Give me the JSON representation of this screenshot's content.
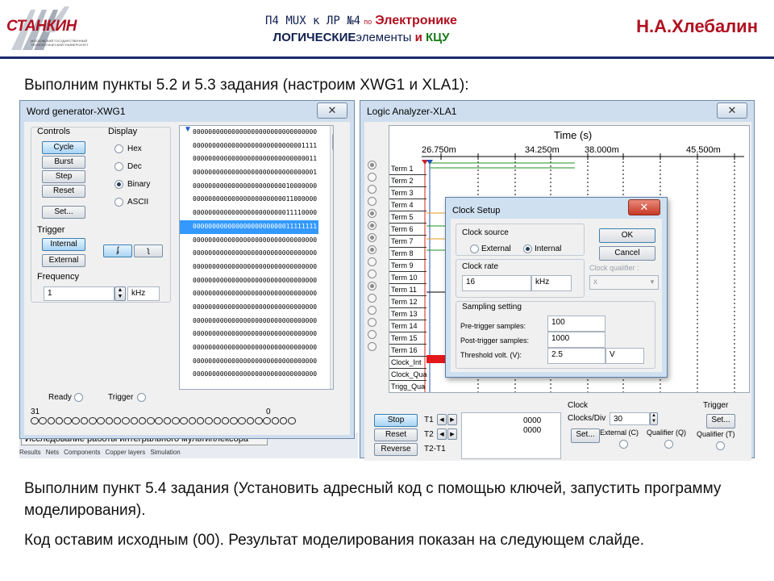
{
  "header": {
    "logo": {
      "brand": "СТАНКИН",
      "subtitle": "МОСКОВСКИЙ ГОСУДАРСТВЕННЫЙ ТЕХНОЛОГИЧЕСКИЙ УНИВЕРСИТЕТ"
    },
    "line1": {
      "part1": "П4 MUX к ЛР №4",
      "part2": "по",
      "part3": "Электронике"
    },
    "line2": {
      "part1": "ЛОГИЧЕСКИЕ",
      "part2": "элементы",
      "part3": "и",
      "part4": "КЦУ"
    },
    "author": "Н.А.Хлебалин",
    "colors": {
      "accent": "#b01020",
      "navy": "#1a2a6e",
      "green": "#1a7a1a"
    }
  },
  "text": {
    "p1": "Выполним пункты 5.2 и 5.3 задания (настроим XWG1 и XLA1):",
    "p2": "Выполним пункт 5.4 задания (Установить адресный код с помощью ключей, запустить программу моделирования).",
    "p3": "Код оставим исходным (00). Результат моделирования показан на следующем слайде."
  },
  "word_generator": {
    "title": "Word generator-XWG1",
    "controls": {
      "label": "Controls",
      "cycle": "Cycle",
      "burst": "Burst",
      "step": "Step",
      "reset": "Reset",
      "set": "Set..."
    },
    "display": {
      "label": "Display",
      "hex": "Hex",
      "dec": "Dec",
      "binary": "Binary",
      "ascii": "ASCII",
      "selected": "Binary"
    },
    "trigger": {
      "label": "Trigger",
      "internal": "Internal",
      "external": "External",
      "edge_rise": "rising-edge-icon",
      "edge_fall": "falling-edge-icon"
    },
    "frequency": {
      "label": "Frequency",
      "value": "1",
      "unit": "kHz"
    },
    "words": [
      "00000000000000000000000000000000",
      "00000000000000000000000000001111",
      "00000000000000000000000000000011",
      "00000000000000000000000000000001",
      "00000000000000000000000010000000",
      "00000000000000000000000011000000",
      "00000000000000000000000011110000",
      "00000000000000000000000011111111",
      "00000000000000000000000000000000",
      "00000000000000000000000000000000",
      "00000000000000000000000000000000",
      "00000000000000000000000000000000",
      "00000000000000000000000000000000",
      "00000000000000000000000000000000",
      "00000000000000000000000000000000",
      "00000000000000000000000000000000",
      "00000000000000000000000000000000",
      "00000000000000000000000000000000",
      "00000000000000000000000000000000"
    ],
    "selected_row": 7,
    "ready": "Ready",
    "trigger_status": "Trigger",
    "bit_high": "31",
    "bit_low": "0"
  },
  "logic_analyzer": {
    "title": "Logic Analyzer-XLA1",
    "time_label": "Time (s)",
    "ticks": [
      "26.750m",
      "34.250m",
      "38.000m",
      "45.500m"
    ],
    "terms": [
      "Term 1",
      "Term 2",
      "Term 3",
      "Term 4",
      "Term 5",
      "Term 6",
      "Term 7",
      "Term 8",
      "Term 9",
      "Term 10",
      "Term 11",
      "Term 12",
      "Term 13",
      "Term 14",
      "Term 15",
      "Term 16",
      "Clock_Int",
      "Clock_Qua",
      "Trigg_Qua"
    ],
    "buttons": {
      "stop": "Stop",
      "reset": "Reset",
      "reverse": "Reverse"
    },
    "cursors": {
      "t1": "T1",
      "t2": "T2",
      "t2t1": "T2-T1",
      "t1_val": "0000",
      "t2_val": "0000"
    },
    "clock": {
      "label": "Clock",
      "clocks_div_label": "Clocks/Div",
      "clocks_div": "30",
      "set": "Set...",
      "external": "External (C)",
      "qualifier": "Qualifier (Q)"
    },
    "trigger": {
      "label": "Trigger",
      "set": "Set...",
      "qualifier": "Qualifier (T)"
    }
  },
  "clock_setup": {
    "title": "Clock Setup",
    "source_label": "Clock source",
    "external": "External",
    "internal": "Internal",
    "selected": "Internal",
    "rate_label": "Clock rate",
    "rate_value": "16",
    "rate_unit": "kHz",
    "qualifier_label": "Clock qualifier :",
    "qualifier_value": "x",
    "sampling_label": "Sampling setting",
    "pre_label": "Pre-trigger samples:",
    "pre_value": "100",
    "post_label": "Post-trigger samples:",
    "post_value": "1000",
    "threshold_label": "Threshold volt. (V):",
    "threshold_value": "2.5",
    "threshold_unit": "V",
    "ok": "OK",
    "cancel": "Cancel"
  },
  "background_tabs": {
    "caption": "Исследование работы интегрального мультиплексора",
    "tabs": [
      "Results",
      "Nets",
      "Components",
      "Copper layers",
      "Simulation"
    ]
  }
}
